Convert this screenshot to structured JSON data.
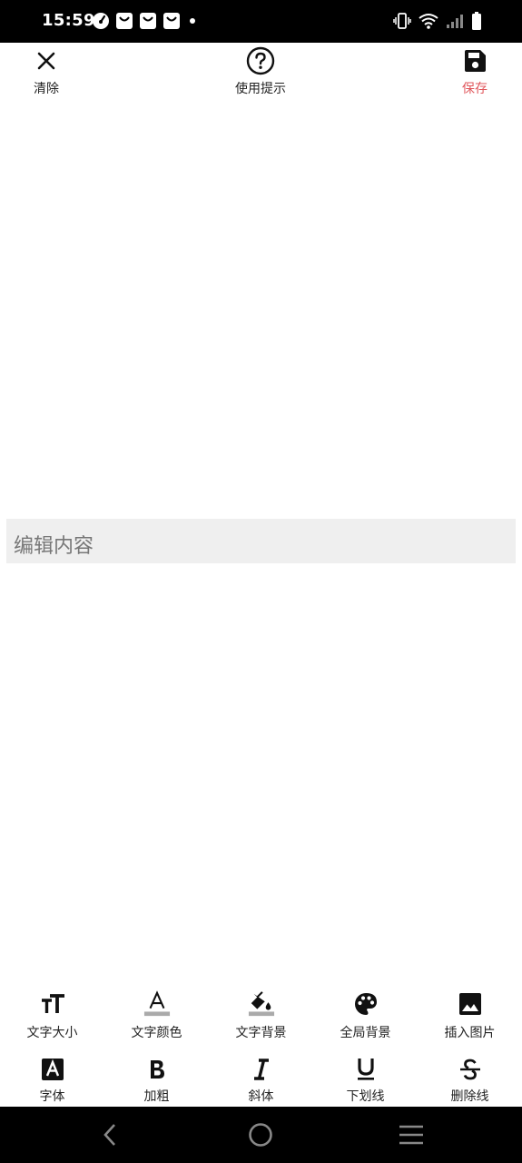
{
  "status_bar": {
    "time": "15:59",
    "notification_icons": [
      "speedometer-icon",
      "shopping-bag-icon",
      "shopping-bag-icon",
      "shopping-bag-icon",
      "dot-icon"
    ],
    "system_icons": [
      "vibrate-icon",
      "wifi-icon",
      "signal-icon",
      "battery-icon"
    ]
  },
  "toolbar": {
    "clear_label": "清除",
    "help_label": "使用提示",
    "save_label": "保存",
    "save_color": "#e0565b"
  },
  "editor": {
    "placeholder": "编辑内容",
    "value": "",
    "background": "#efefef"
  },
  "format_bar": {
    "row1": [
      {
        "label": "文字大小",
        "icon": "text-size-icon"
      },
      {
        "label": "文字颜色",
        "icon": "text-color-icon"
      },
      {
        "label": "文字背景",
        "icon": "text-background-icon"
      },
      {
        "label": "全局背景",
        "icon": "palette-icon"
      },
      {
        "label": "插入图片",
        "icon": "image-icon"
      }
    ],
    "row2": [
      {
        "label": "字体",
        "icon": "font-icon"
      },
      {
        "label": "加粗",
        "icon": "bold-icon"
      },
      {
        "label": "斜体",
        "icon": "italic-icon"
      },
      {
        "label": "下划线",
        "icon": "underline-icon"
      },
      {
        "label": "删除线",
        "icon": "strikethrough-icon"
      }
    ]
  },
  "nav_bar": {
    "icons": [
      "back-icon",
      "home-icon",
      "menu-icon"
    ]
  }
}
